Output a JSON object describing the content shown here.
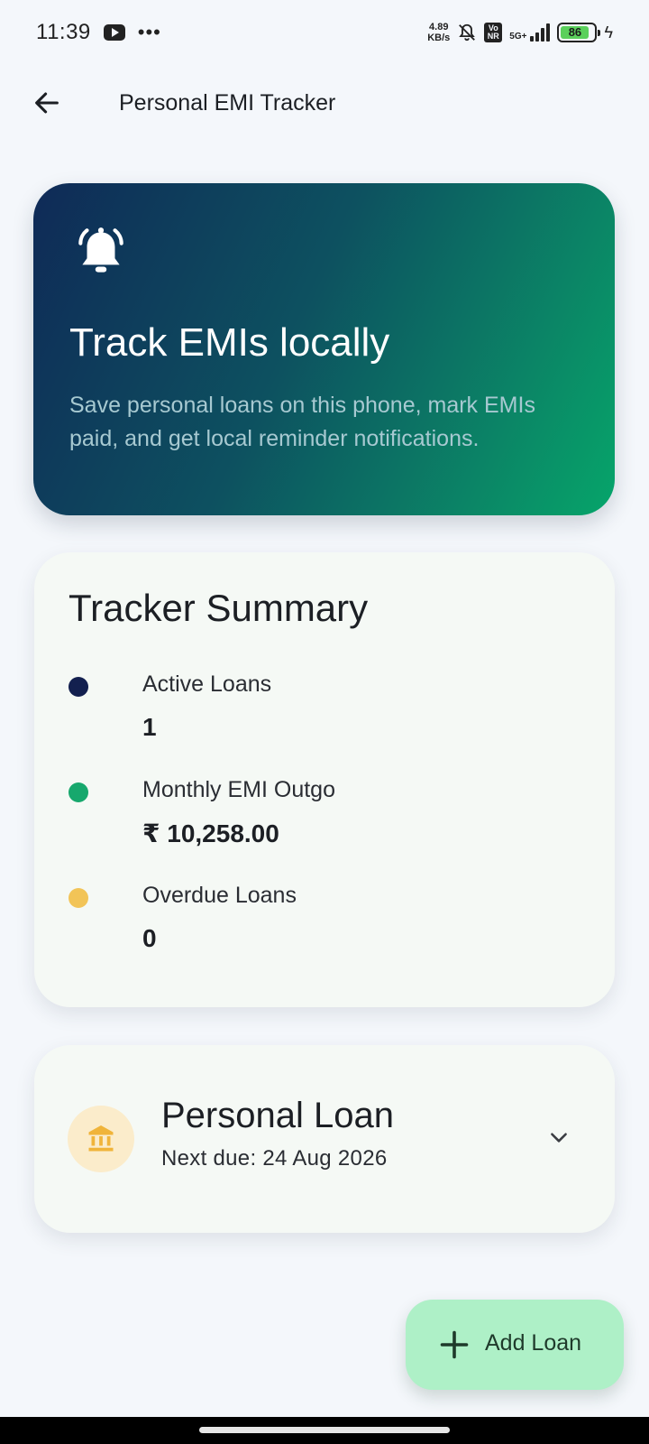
{
  "status_bar": {
    "time": "11:39",
    "net_speed_value": "4.89",
    "net_speed_unit": "KB/s",
    "volte_top": "Vo",
    "volte_bottom": "NR",
    "network_label": "5G+",
    "battery_level": "86",
    "battery_fill_fraction": 0.86,
    "icons": [
      "youtube-icon",
      "more-dots-icon",
      "bell-off-icon",
      "volte-icon",
      "signal-icon",
      "battery-icon",
      "charging-bolt-icon"
    ]
  },
  "app_bar": {
    "title": "Personal EMI Tracker",
    "back_icon": "arrow-left-icon"
  },
  "hero": {
    "icon": "bell-ringing-icon",
    "title": "Track EMIs locally",
    "subtitle": "Save personal loans on this phone, mark EMIs paid, and get local reminder notifications."
  },
  "summary": {
    "title": "Tracker Summary",
    "stats": [
      {
        "label": "Active Loans",
        "value": "1",
        "dot_color": "#13204f"
      },
      {
        "label": "Monthly EMI Outgo",
        "value": "₹ 10,258.00",
        "dot_color": "#17a86d"
      },
      {
        "label": "Overdue Loans",
        "value": "0",
        "dot_color": "#f2c457"
      }
    ]
  },
  "loan_card": {
    "icon": "bank-icon",
    "title": "Personal Loan",
    "next_due": "Next due: 24 Aug 2026",
    "expand_icon": "chevron-down-icon"
  },
  "fab": {
    "icon": "plus-icon",
    "label": "Add Loan"
  },
  "colors": {
    "background": "#f4f7fb",
    "card": "#f5f9f5",
    "hero_gradient_start": "#0f2a57",
    "hero_gradient_end": "#06a56a",
    "fab": "#aef0c7",
    "loan_icon_bg": "#fbeccb",
    "loan_icon_fg": "#f0b43a"
  }
}
